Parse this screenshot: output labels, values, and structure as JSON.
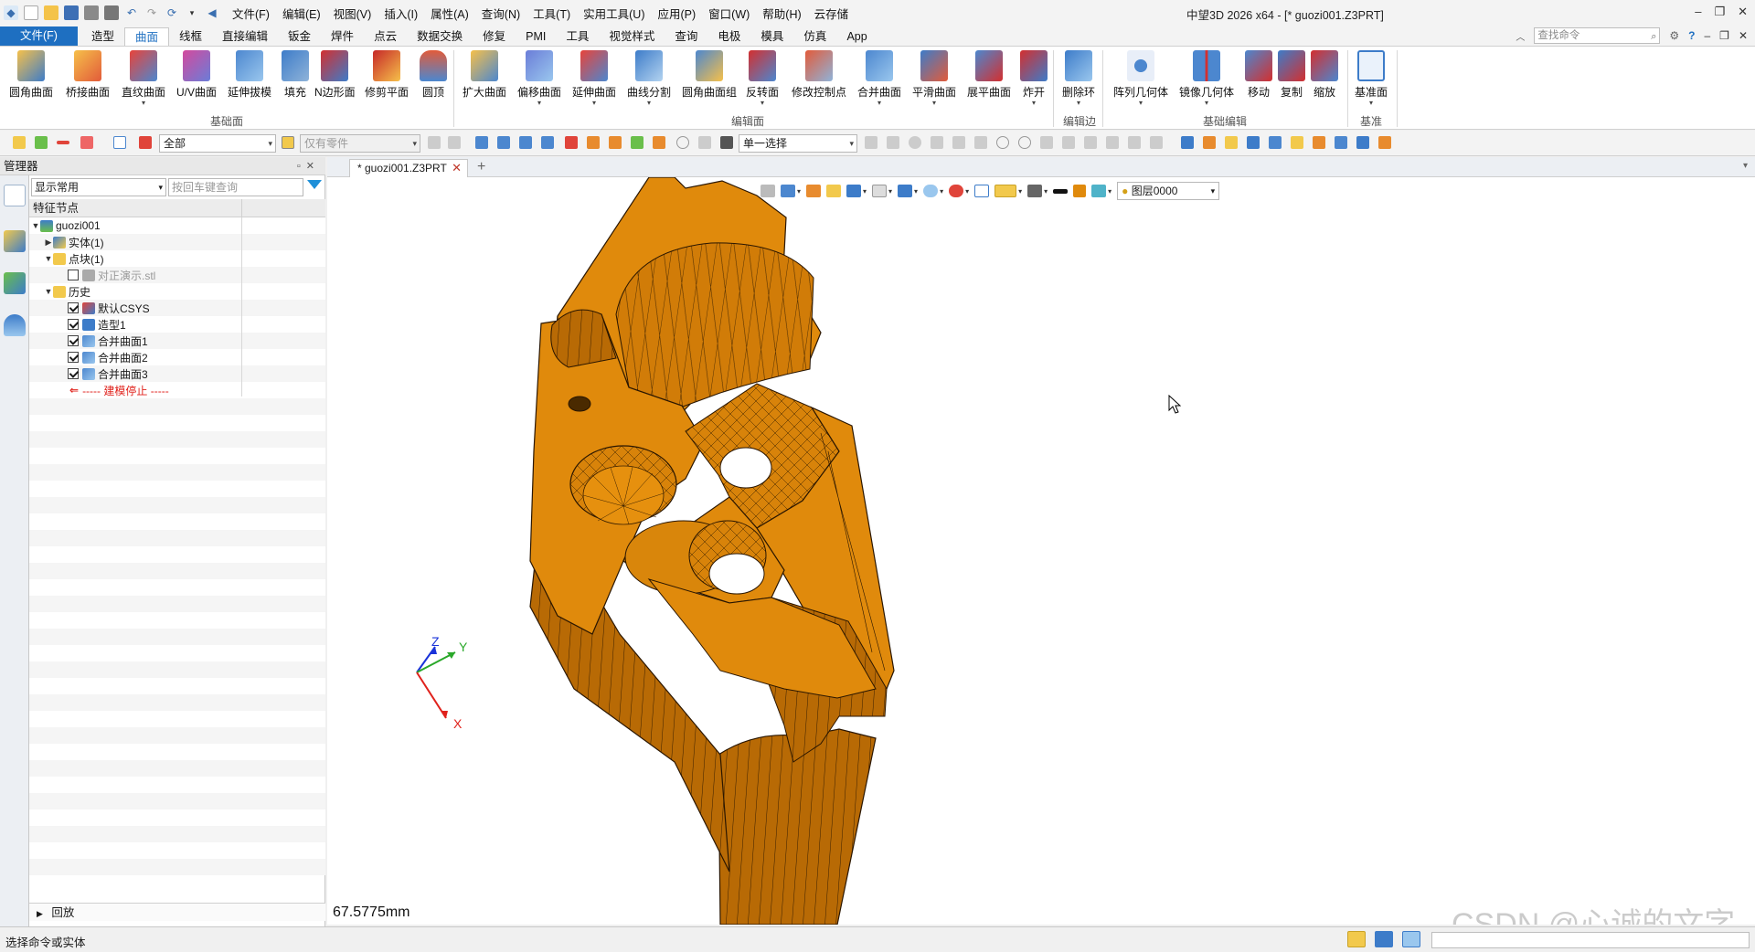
{
  "app": {
    "title": "中望3D 2026 x64  - [* guozi001.Z3PRT]"
  },
  "menu": [
    "文件(F)",
    "编辑(E)",
    "视图(V)",
    "插入(I)",
    "属性(A)",
    "查询(N)",
    "工具(T)",
    "实用工具(U)",
    "应用(P)",
    "窗口(W)",
    "帮助(H)",
    "云存储"
  ],
  "ribbon_tabs": [
    "文件(F)",
    "造型",
    "曲面",
    "线框",
    "直接编辑",
    "钣金",
    "焊件",
    "点云",
    "数据交换",
    "修复",
    "PMI",
    "工具",
    "视觉样式",
    "查询",
    "电极",
    "模具",
    "仿真",
    "App"
  ],
  "ribbon_active_tab": "曲面",
  "search_cmd_placeholder": "查找命令",
  "ribbon_groups": {
    "basic": {
      "label": "基础面",
      "buttons": [
        "圆角曲面",
        "桥接曲面",
        "直纹曲面",
        "U/V曲面",
        "延伸拔模",
        "填充",
        "N边形面",
        "修剪平面",
        "圆顶"
      ]
    },
    "edit": {
      "label": "编辑面",
      "buttons": [
        "扩大曲面",
        "偏移曲面",
        "延伸曲面",
        "曲线分割",
        "圆角曲面组",
        "反转面",
        "修改控制点",
        "合并曲面",
        "平滑曲面",
        "展平曲面",
        "炸开"
      ]
    },
    "edge": {
      "label": "编辑边",
      "buttons": [
        "删除环"
      ]
    },
    "geom": {
      "label": "基础编辑",
      "buttons": [
        "阵列几何体",
        "镜像几何体",
        "移动",
        "复制",
        "缩放"
      ]
    },
    "datum": {
      "label": "基准",
      "buttons": [
        "基准面"
      ]
    }
  },
  "toolbar2": {
    "filter_all": "全部",
    "parts_only": "仅有零件",
    "select_mode": "单一选择"
  },
  "manager": {
    "title": "管理器",
    "display_combo": "显示常用",
    "search_placeholder": "按回车键查询",
    "tree_header": "特征节点",
    "tree": [
      {
        "label": "guozi001",
        "level": 0
      },
      {
        "label": "实体(1)",
        "level": 1
      },
      {
        "label": "点块(1)",
        "level": 1
      },
      {
        "label": "对正演示.stl",
        "level": 2
      },
      {
        "label": "历史",
        "level": 1
      },
      {
        "label": "默认CSYS",
        "level": 2
      },
      {
        "label": "造型1",
        "level": 2
      },
      {
        "label": "合并曲面1",
        "level": 2
      },
      {
        "label": "合并曲面2",
        "level": 2
      },
      {
        "label": "合并曲面3",
        "level": 2
      },
      {
        "label": "----- 建模停止 -----",
        "level": 2
      }
    ],
    "footer": "回放"
  },
  "document_tab": "* guozi001.Z3PRT",
  "viewport": {
    "layer": "图层0000",
    "measure": "67.5775mm",
    "axes": [
      "Z",
      "Y",
      "X"
    ],
    "watermark": "CSDN @心诚的文字"
  },
  "status": {
    "text": "选择命令或实体"
  },
  "colors": {
    "accent": "#1e6fc1",
    "model": "#e08a0c",
    "stop_marker": "#e0221c"
  }
}
